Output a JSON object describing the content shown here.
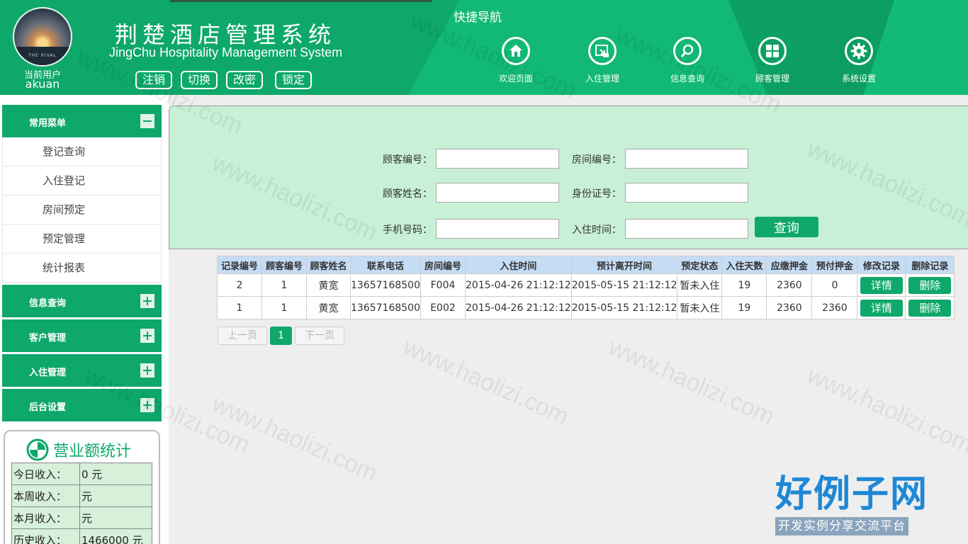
{
  "header": {
    "current_user_label": "当前用户",
    "username": "akuan",
    "avatar_caption": "THE RIVAL",
    "title": "荆楚酒店管理系统",
    "subtitle": "JingChu Hospitality Management System",
    "buttons": [
      "注销",
      "切换",
      "改密",
      "锁定"
    ],
    "quick_nav_title": "快捷导航",
    "quick_nav": [
      {
        "label": "欢迎页面",
        "icon": "home-icon"
      },
      {
        "label": "入住管理",
        "icon": "checkin-icon"
      },
      {
        "label": "信息查询",
        "icon": "search-icon"
      },
      {
        "label": "顾客管理",
        "icon": "grid-icon"
      },
      {
        "label": "系统设置",
        "icon": "gear-icon"
      }
    ]
  },
  "sidebar": {
    "common_menu": "常用菜单",
    "common_items": [
      "登记查询",
      "入住登记",
      "房间预定",
      "预定管理",
      "统计报表"
    ],
    "sections": [
      "信息查询",
      "客户管理",
      "入住管理",
      "后台设置"
    ],
    "stats": {
      "title": "营业额统计",
      "rows": [
        {
          "label": "今日收入：",
          "value": "0 元"
        },
        {
          "label": "本周收入：",
          "value": "元"
        },
        {
          "label": "本月收入：",
          "value": "元"
        },
        {
          "label": "历史收入：",
          "value": "1466000 元"
        }
      ]
    }
  },
  "search": {
    "customer_id": "顾客编号：",
    "room_id": "房间编号：",
    "customer_name": "顾客姓名：",
    "id_card": "身份证号：",
    "phone": "手机号码：",
    "checkin_time": "入住时间：",
    "query_button": "查询"
  },
  "table": {
    "headers": [
      "记录编号",
      "顾客编号",
      "顾客姓名",
      "联系电话",
      "房间编号",
      "入住时间",
      "预计离开时间",
      "预定状态",
      "入住天数",
      "应缴押金",
      "预付押金",
      "修改记录",
      "删除记录"
    ],
    "rows": [
      [
        "2",
        "1",
        "黄宽",
        "13657168500",
        "F004",
        "2015-04-26 21:12:12",
        "2015-05-15 21:12:12",
        "暂未入住",
        "19",
        "2360",
        "0"
      ],
      [
        "1",
        "1",
        "黄宽",
        "13657168500",
        "E002",
        "2015-04-26 21:12:12",
        "2015-05-15 21:12:12",
        "暂未入住",
        "19",
        "2360",
        "2360"
      ]
    ],
    "detail_button": "详情",
    "delete_button": "删除"
  },
  "pager": {
    "prev": "上一页",
    "current": "1",
    "next": "下一页"
  },
  "watermark": "www.haolizi.com",
  "brand": {
    "name": "好例子网",
    "slogan": "开发实例分享交流平台"
  },
  "colors": {
    "primary": "#0ea86a",
    "panel": "#c8f0d6",
    "table_header": "#c5dcf5"
  }
}
